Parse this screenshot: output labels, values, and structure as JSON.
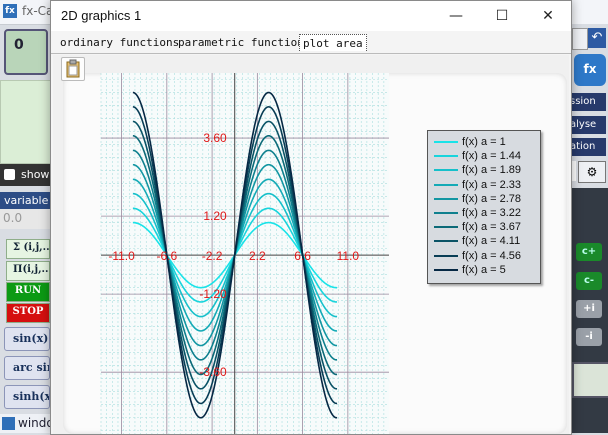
{
  "background_app": {
    "title": "fx-Ca",
    "display_value": "0",
    "show_label": "show",
    "variable_label": "variable",
    "variable_value": "0.0",
    "buttons": [
      "Σ (i,j,...",
      "Π(i,j,...",
      "RUN",
      "STOP"
    ],
    "func_buttons": [
      "sin(x)",
      "arc sin(",
      "sinh(x"
    ],
    "taskbar_label": "windo",
    "right_labels": [
      "ssion",
      "alyse",
      "ation"
    ],
    "arrow_buttons": [
      "c+",
      "c-",
      "+i",
      "-i"
    ]
  },
  "dialog": {
    "title": "2D graphics 1",
    "controls": {
      "minimize": "—",
      "maximize": "☐",
      "close": "✕"
    },
    "tabs": [
      "ordinary functions",
      "parametric function",
      "plot area"
    ],
    "active_tab": "plot area"
  },
  "chart_data": {
    "type": "line",
    "function": "f(x) = a·sin(x·π/6.6)",
    "xlim": [
      -13,
      15
    ],
    "ylim": [
      -5.5,
      5.6
    ],
    "x_ticks": [
      "-11.0",
      "-6.6",
      "-2.2",
      "2.2",
      "6.6",
      "11.0"
    ],
    "y_ticks": [
      "3.60",
      "1.20",
      "-1.20",
      "-3.60"
    ],
    "grid": true,
    "legend_position": "top-right",
    "series": [
      {
        "name": "f(x) a = 1",
        "a": 1,
        "color": "#19e3e8"
      },
      {
        "name": "f(x) a = 1.44",
        "a": 1.44,
        "color": "#18d4dc"
      },
      {
        "name": "f(x) a = 1.89",
        "a": 1.89,
        "color": "#16c0ca"
      },
      {
        "name": "f(x) a = 2.33",
        "a": 2.33,
        "color": "#14aab6"
      },
      {
        "name": "f(x) a = 2.78",
        "a": 2.78,
        "color": "#1296a2"
      },
      {
        "name": "f(x) a = 3.22",
        "a": 3.22,
        "color": "#0f808e"
      },
      {
        "name": "f(x) a = 3.67",
        "a": 3.67,
        "color": "#0c6a78"
      },
      {
        "name": "f(x) a = 4.11",
        "a": 4.11,
        "color": "#0a5366"
      },
      {
        "name": "f(x) a = 4.56",
        "a": 4.56,
        "color": "#083d55"
      },
      {
        "name": "f(x) a = 5",
        "a": 5,
        "color": "#062844"
      }
    ]
  }
}
